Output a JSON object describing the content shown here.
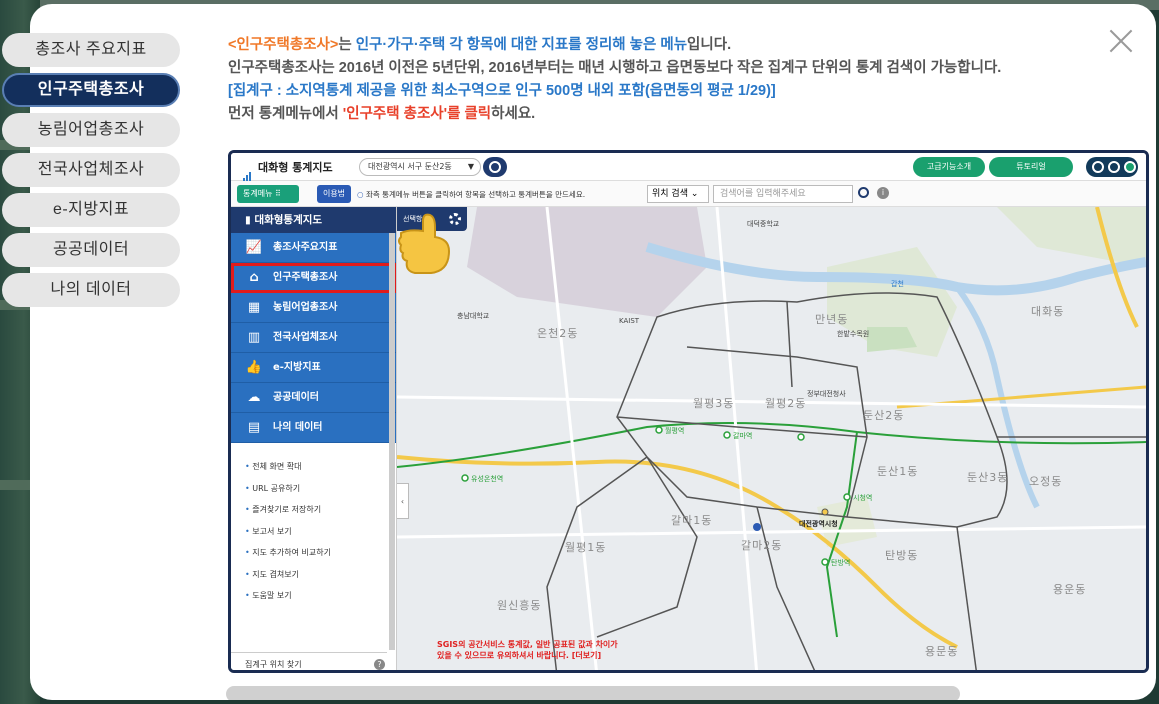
{
  "modal": {
    "close_label": "×"
  },
  "tabs": [
    {
      "label": "총조사 주요지표",
      "active": false
    },
    {
      "label": "인구주택총조사",
      "active": true
    },
    {
      "label": "농림어업총조사",
      "active": false
    },
    {
      "label": "전국사업체조사",
      "active": false
    },
    {
      "label": "e-지방지표",
      "active": false
    },
    {
      "label": "공공데이터",
      "active": false
    },
    {
      "label": "나의 데이터",
      "active": false
    }
  ],
  "intro": {
    "line1_a": "<인구주택총조사>",
    "line1_b": "는 ",
    "line1_c": "인구·가구·주택 각 항목에 대한 지표를 정리해 놓은 메뉴",
    "line1_d": "입니다.",
    "line2": "인구주택총조사는 2016년 이전은 5년단위, 2016년부터는 매년 시행하고 읍면동보다 작은 집계구 단위의 통계 검색이 가능합니다.",
    "line3": "[집계구 : 소지역통계 제공을 위한 최소구역으로 인구 500명 내외 포함(읍면동의 평균 1/29)]",
    "line4_a": "먼저 통계메뉴에서 ",
    "line4_b": "'인구주택 총조사'를 클릭",
    "line4_c": "하세요."
  },
  "shot": {
    "app_title": "대화형 통계지도",
    "region_select": "대전광역시 서구 둔산2동",
    "btn_advanced": "고급기능소개",
    "btn_tutorial": "튜토리얼",
    "menu_btn": "통계메뉴",
    "use_btn": "이용법",
    "toolbar_hint": "좌측 통계메뉴 버튼을 클릭하여 항목을 선택하고 통계버튼을 만드세요.",
    "loc_select": "위치 검색",
    "search_placeholder": "검색어를 입력해주세요",
    "side_title": "대화형통계지도",
    "side_items": [
      {
        "label": "총조사주요지표",
        "icon": "chart-icon"
      },
      {
        "label": "인구주택총조사",
        "icon": "house-icon"
      },
      {
        "label": "농림어업총조사",
        "icon": "farm-icon"
      },
      {
        "label": "전국사업체조사",
        "icon": "building-icon"
      },
      {
        "label": "e-지방지표",
        "icon": "thumb-icon"
      },
      {
        "label": "공공데이터",
        "icon": "cloud-icon"
      },
      {
        "label": "나의 데이터",
        "icon": "doc-icon"
      }
    ],
    "side_links": [
      "전체 화면 확대",
      "URL 공유하기",
      "즐겨찾기로 저장하기",
      "보고서 보기",
      "지도 추가하여 비교하기",
      "지도 겹쳐보기",
      "도움말 보기"
    ],
    "side_footer": "집계구 위치 찾기",
    "map_select_tab": "선택항목",
    "map_warning_1": "SGIS의 공간서비스 통계값, 일반 공표된 값과 차이가",
    "map_warning_2": "있을 수 있으므로 유의하셔서 바랍니다. [더보기]",
    "map_labels": {
      "l1": "온천2동",
      "l2": "만년동",
      "l3": "월평3동",
      "l4": "월평2동",
      "l5": "둔산2동",
      "l6": "둔산1동",
      "l7": "갈마1동",
      "l8": "갈마2동",
      "l9": "월평1동",
      "l10": "탄방동",
      "l11": "원신흥동",
      "l12": "둔산3동",
      "l13": "대화동",
      "l14": "오정동",
      "l15": "용문동",
      "l16": "용운동",
      "l17": "KAIST",
      "l18": "대전광역시청",
      "l19": "충남대학교",
      "l20": "대덕중학교",
      "l21": "한밭수목원",
      "l22": "정부대전청사",
      "l23": "갑천",
      "l24": "유성온천역",
      "l25": "월평역",
      "l26": "갈마역",
      "l27": "시청역",
      "l28": "탄방역"
    }
  }
}
